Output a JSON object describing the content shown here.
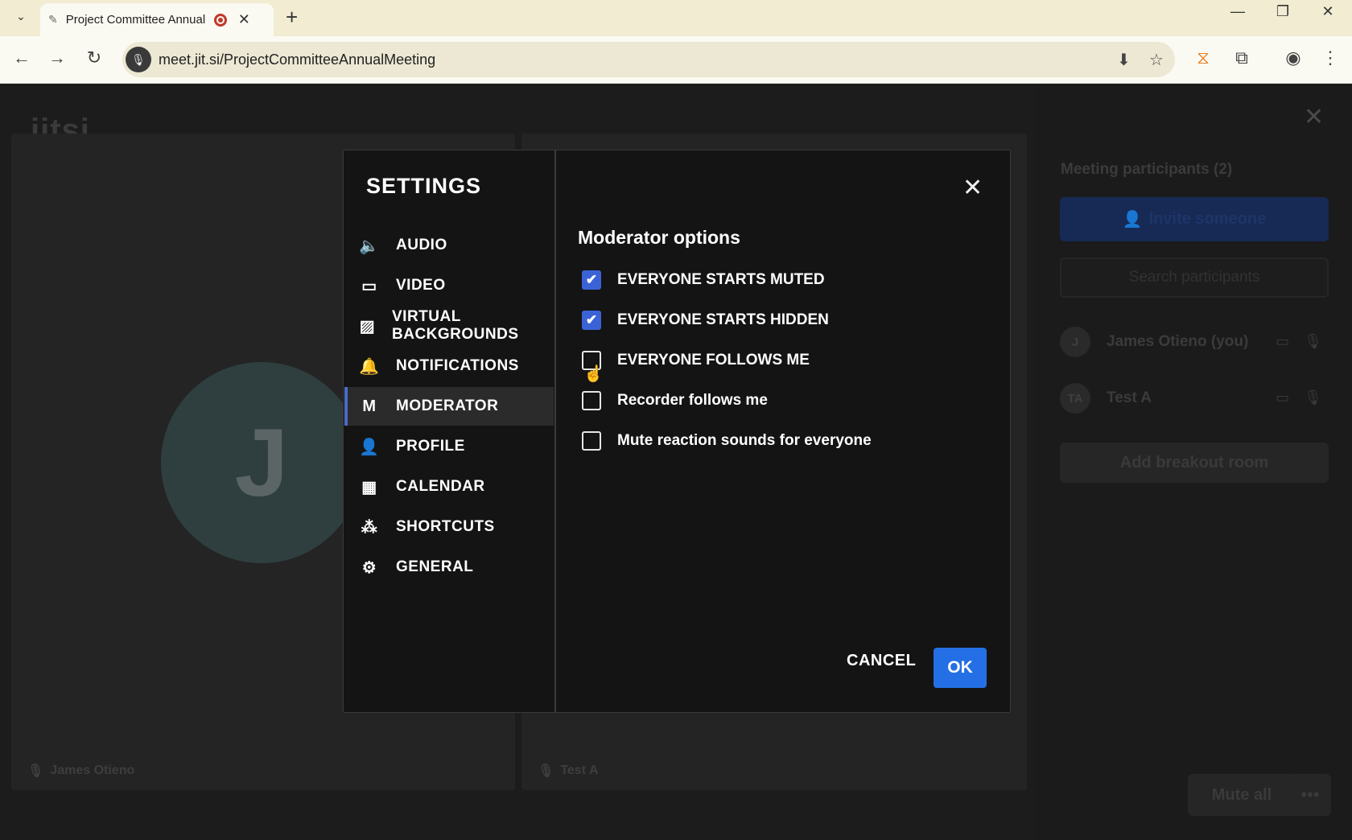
{
  "browser": {
    "tab_title": "Project Committee Annual",
    "url": "meet.jit.si/ProjectCommitteeAnnualMeeting"
  },
  "stage": {
    "logo": "jitsi",
    "avatar_letter": "J",
    "tile1_name": "James Otieno",
    "tile2_name": "Test A"
  },
  "panel": {
    "title": "Meeting participants (2)",
    "invite_label": "Invite someone",
    "search_placeholder": "Search participants",
    "participants": [
      {
        "initials": "J",
        "name": "James Otieno (you)"
      },
      {
        "initials": "TA",
        "name": "Test A"
      }
    ],
    "breakout_label": "Add breakout room",
    "mute_all_label": "Mute all"
  },
  "dialog": {
    "title": "SETTINGS",
    "sidebar": [
      {
        "label": "AUDIO",
        "icon": "speaker-icon"
      },
      {
        "label": "VIDEO",
        "icon": "video-icon"
      },
      {
        "label": "VIRTUAL BACKGROUNDS",
        "icon": "image-icon"
      },
      {
        "label": "NOTIFICATIONS",
        "icon": "bell-icon"
      },
      {
        "label": "MODERATOR",
        "icon": "moderator-icon"
      },
      {
        "label": "PROFILE",
        "icon": "person-icon"
      },
      {
        "label": "CALENDAR",
        "icon": "calendar-icon"
      },
      {
        "label": "SHORTCUTS",
        "icon": "shortcuts-icon"
      },
      {
        "label": "GENERAL",
        "icon": "gear-icon"
      }
    ],
    "active_item": "MODERATOR",
    "section_title": "Moderator options",
    "options": [
      {
        "label": "EVERYONE STARTS MUTED",
        "checked": true
      },
      {
        "label": "EVERYONE STARTS HIDDEN",
        "checked": true
      },
      {
        "label": "EVERYONE FOLLOWS ME",
        "checked": false
      },
      {
        "label": "Recorder follows me",
        "checked": false
      },
      {
        "label": "Mute reaction sounds for everyone",
        "checked": false
      }
    ],
    "cancel_label": "CANCEL",
    "ok_label": "OK"
  },
  "colors": {
    "accent": "#246fe5",
    "checkbox_on": "#3b63d6"
  }
}
